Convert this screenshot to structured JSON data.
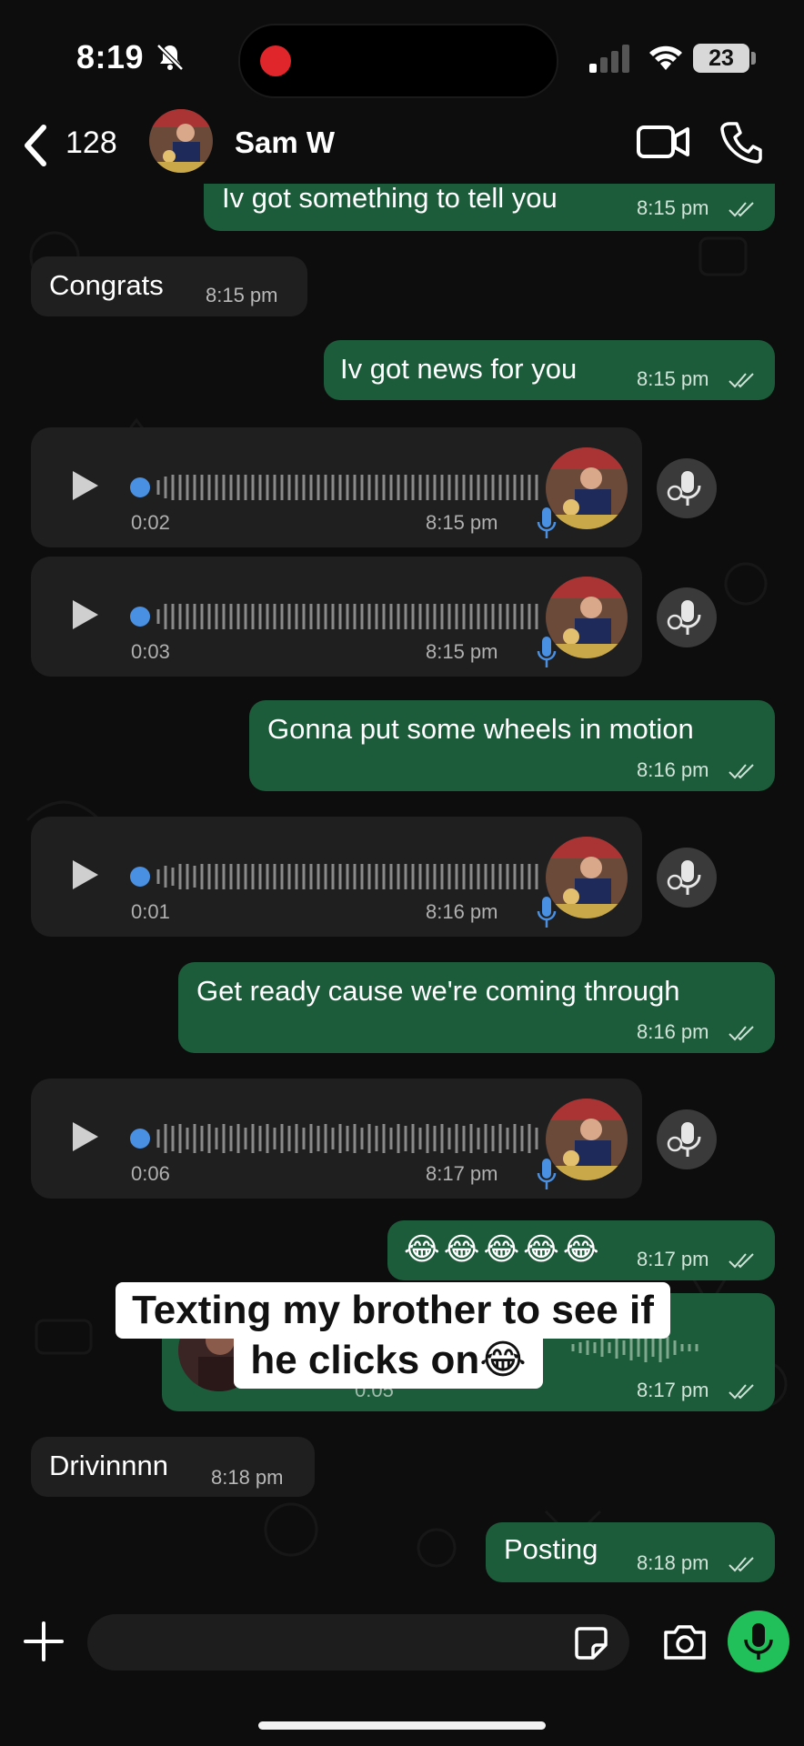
{
  "status_bar": {
    "time": "8:19",
    "battery": "23"
  },
  "header": {
    "back_count": "128",
    "contact_name": "Sam W"
  },
  "messages": [
    {
      "kind": "out",
      "text": "Iv got something to tell you",
      "time": "8:15 pm"
    },
    {
      "kind": "in",
      "text": "Congrats",
      "time": "8:15 pm"
    },
    {
      "kind": "out",
      "text": "Iv got news for you",
      "time": "8:15 pm"
    },
    {
      "kind": "voice",
      "duration": "0:02",
      "time": "8:15 pm"
    },
    {
      "kind": "voice",
      "duration": "0:03",
      "time": "8:15 pm"
    },
    {
      "kind": "out",
      "text": "Gonna put some wheels in motion",
      "time": "8:16 pm"
    },
    {
      "kind": "voice",
      "duration": "0:01",
      "time": "8:16 pm"
    },
    {
      "kind": "out",
      "text": "Get ready cause we're coming through",
      "time": "8:16 pm"
    },
    {
      "kind": "voice",
      "duration": "0:06",
      "time": "8:17 pm"
    },
    {
      "kind": "out",
      "text": "😂😂😂😂😂",
      "time": "8:17 pm"
    },
    {
      "kind": "out-voice",
      "duration": "0:05",
      "time": "8:17 pm"
    },
    {
      "kind": "in",
      "text": "Drivinnnn",
      "time": "8:18 pm"
    },
    {
      "kind": "out",
      "text": "Posting",
      "time": "8:18 pm"
    }
  ],
  "overlay_caption": {
    "line1": "Texting my brother to see if",
    "line2": "he clicks on😂"
  },
  "colors": {
    "outgoing_bubble": "#1c5c3b",
    "incoming_bubble": "#1f1f1f",
    "accent": "#22c05a",
    "voice_dot": "#4a90e2"
  },
  "icons": [
    "back-chevron-icon",
    "video-call-icon",
    "phone-icon",
    "play-icon",
    "mic-icon",
    "plus-icon",
    "sticker-icon",
    "camera-icon",
    "read-ticks-icon",
    "muted-bell-icon",
    "wifi-icon",
    "signal-icon"
  ]
}
